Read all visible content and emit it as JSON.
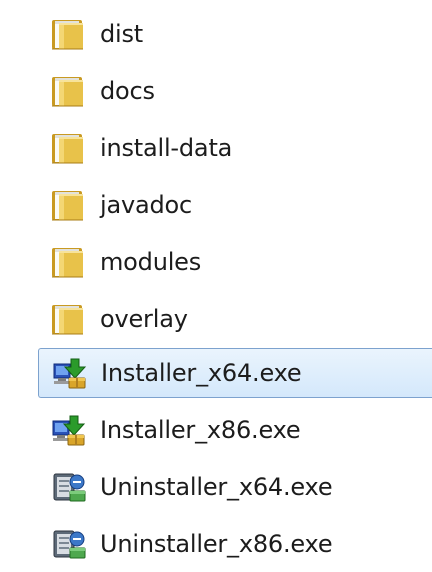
{
  "explorer": {
    "items": [
      {
        "name": "dist",
        "type": "folder",
        "selected": false
      },
      {
        "name": "docs",
        "type": "folder",
        "selected": false
      },
      {
        "name": "install-data",
        "type": "folder",
        "selected": false
      },
      {
        "name": "javadoc",
        "type": "folder",
        "selected": false
      },
      {
        "name": "modules",
        "type": "folder",
        "selected": false
      },
      {
        "name": "overlay",
        "type": "folder",
        "selected": false
      },
      {
        "name": "Installer_x64.exe",
        "type": "installer-exe",
        "selected": true
      },
      {
        "name": "Installer_x86.exe",
        "type": "installer-exe",
        "selected": false
      },
      {
        "name": "Uninstaller_x64.exe",
        "type": "uninstaller-exe",
        "selected": false
      },
      {
        "name": "Uninstaller_x86.exe",
        "type": "uninstaller-exe",
        "selected": false
      }
    ]
  },
  "colors": {
    "folder": "#e8c24a",
    "folder_dark": "#c99a22",
    "selection_border": "#7da2ce",
    "text": "#1c1c1c"
  }
}
